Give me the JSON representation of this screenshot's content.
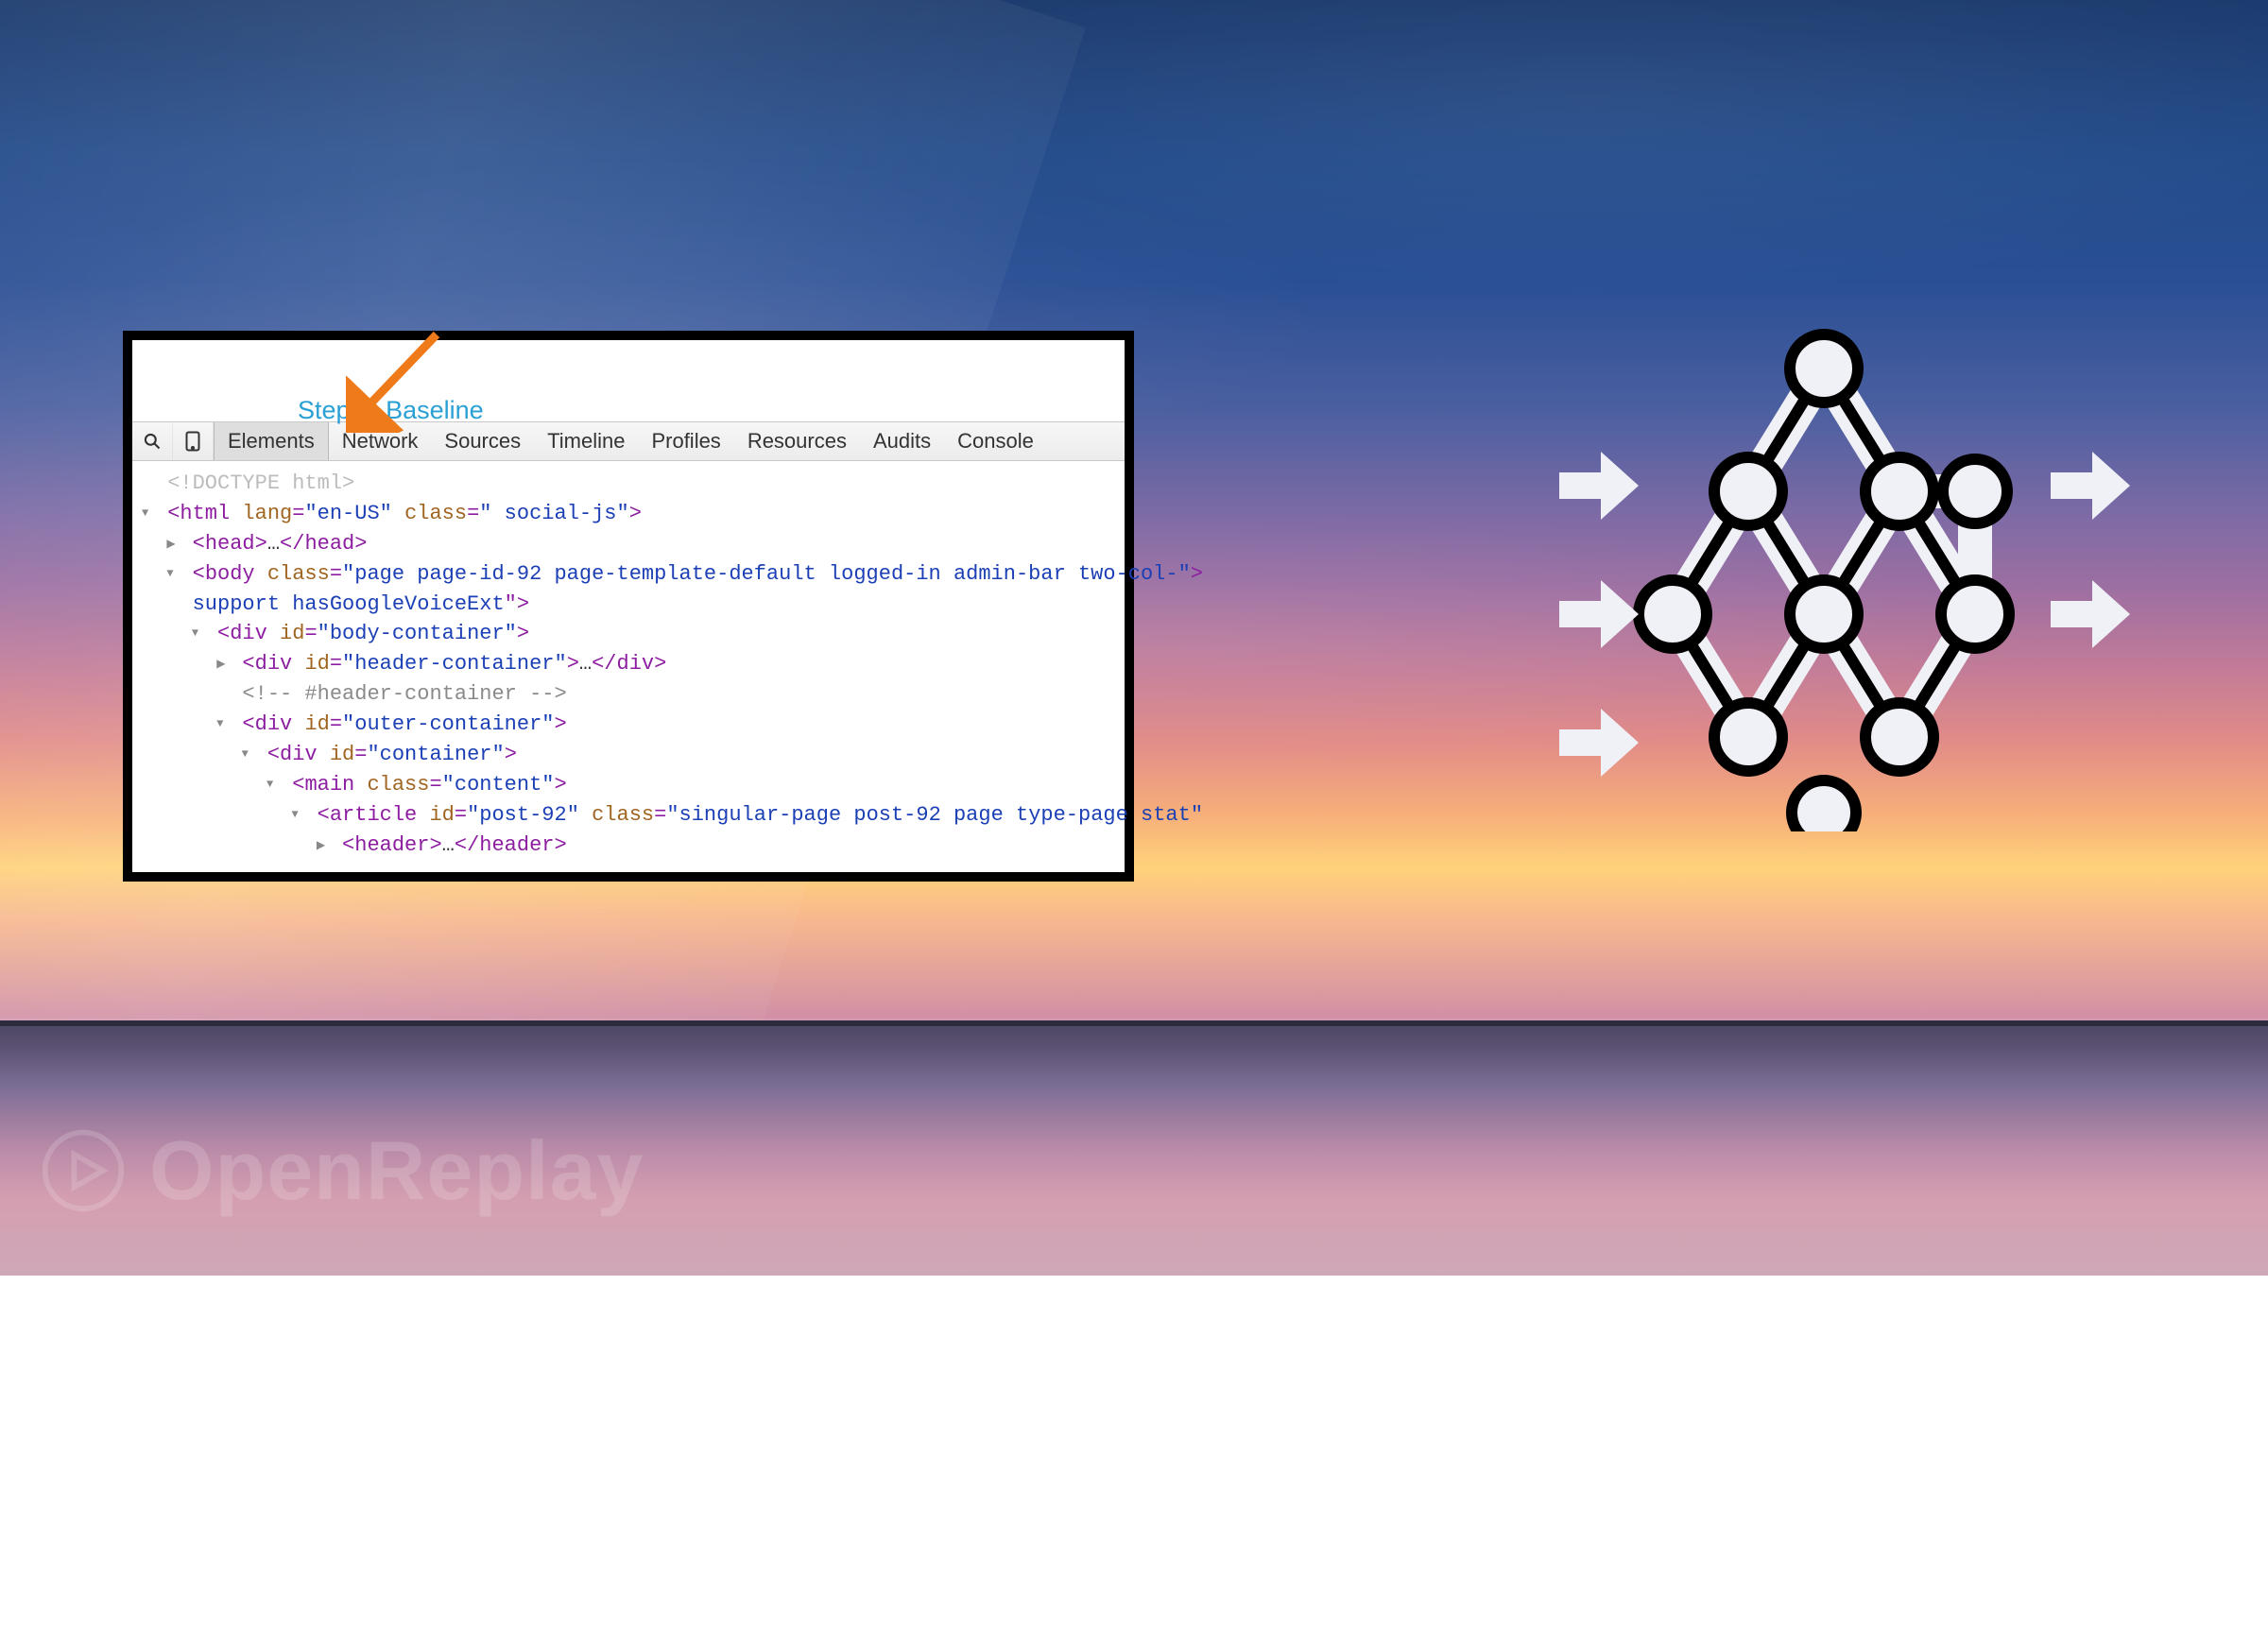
{
  "watermark_text": "OpenReplay",
  "step_caption": "Step 0: Baseline",
  "devtools": {
    "tabs": [
      "Elements",
      "Network",
      "Sources",
      "Timeline",
      "Profiles",
      "Resources",
      "Audits",
      "Console"
    ],
    "active_tab": "Elements",
    "dom_lines": [
      {
        "indent": 0,
        "tri": "",
        "kind": "doctype",
        "text": "<!DOCTYPE html>"
      },
      {
        "indent": 0,
        "tri": "open",
        "kind": "open",
        "tag": "html",
        "attrs": [
          [
            "lang",
            "en-US"
          ],
          [
            "class",
            " social-js"
          ]
        ]
      },
      {
        "indent": 1,
        "tri": "closed",
        "kind": "collapsed",
        "tag": "head"
      },
      {
        "indent": 1,
        "tri": "open",
        "kind": "open",
        "tag": "body",
        "attrs": [
          [
            "class",
            "page page-id-92 page-template-default logged-in admin-bar two-col-"
          ]
        ]
      },
      {
        "indent": 1,
        "tri": "",
        "kind": "continuation",
        "text": "support hasGoogleVoiceExt\">"
      },
      {
        "indent": 2,
        "tri": "open",
        "kind": "open",
        "tag": "div",
        "attrs": [
          [
            "id",
            "body-container"
          ]
        ]
      },
      {
        "indent": 3,
        "tri": "closed",
        "kind": "collapsed",
        "tag": "div",
        "attrs": [
          [
            "id",
            "header-container"
          ]
        ]
      },
      {
        "indent": 3,
        "tri": "",
        "kind": "comment",
        "text": "<!-- #header-container -->"
      },
      {
        "indent": 3,
        "tri": "open",
        "kind": "open",
        "tag": "div",
        "attrs": [
          [
            "id",
            "outer-container"
          ]
        ]
      },
      {
        "indent": 4,
        "tri": "open",
        "kind": "open",
        "tag": "div",
        "attrs": [
          [
            "id",
            "container"
          ]
        ]
      },
      {
        "indent": 5,
        "tri": "open",
        "kind": "open",
        "tag": "main",
        "attrs": [
          [
            "class",
            "content"
          ]
        ]
      },
      {
        "indent": 6,
        "tri": "open",
        "kind": "open",
        "tag": "article",
        "attrs": [
          [
            "id",
            "post-92"
          ],
          [
            "class",
            "singular-page post-92 page type-page stat"
          ]
        ],
        "unterminated": true
      },
      {
        "indent": 7,
        "tri": "closed",
        "kind": "collapsed",
        "tag": "header"
      }
    ]
  },
  "colors": {
    "tag_purple": "#8d1da0",
    "attr_name_brown": "#a06521",
    "attr_value_blue": "#1b3fb5",
    "caption_blue": "#2aa0d4",
    "arrow_orange": "#ef7a1a"
  }
}
